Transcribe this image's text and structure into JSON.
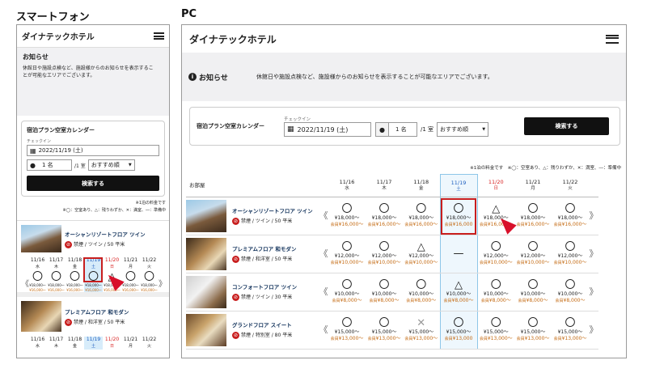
{
  "labels": {
    "sp": "スマートフォン",
    "pc": "PC"
  },
  "hotel": "ダイナテックホテル",
  "announce": {
    "title": "お知らせ",
    "body": "休館日や施設点検など、施設様からのお知らせを表示することが可能なエリアでございます。",
    "body_sp1": "休館日や施設点検など、施設様からのお知らせを表示するこ",
    "body_sp2": "とが可能なエリアでございます。"
  },
  "calendar": {
    "title": "宿泊プラン空室カレンダー",
    "checkin_label": "チェックイン",
    "date": "2022/11/19 (土)",
    "persons": "1 名",
    "per_room": "/1 室",
    "sort": "おすすめ順",
    "search": "検索する"
  },
  "note1": "※1泊の料金です",
  "note2": "※◯：空室あり、△：残りわずか、✕：満室、―：準備中",
  "note_pc": "※1泊の料金です　※◯：空室あり、△：残りわずか、✕：満室、―：準備中",
  "room_header": "お部屋",
  "dates": [
    {
      "d": "11/16",
      "w": "水",
      "c": ""
    },
    {
      "d": "11/17",
      "w": "木",
      "c": ""
    },
    {
      "d": "11/18",
      "w": "金",
      "c": ""
    },
    {
      "d": "11/19",
      "w": "土",
      "c": "blu"
    },
    {
      "d": "11/20",
      "w": "日",
      "c": "red"
    },
    {
      "d": "11/21",
      "w": "月",
      "c": ""
    },
    {
      "d": "11/22",
      "w": "火",
      "c": ""
    }
  ],
  "rooms": [
    {
      "name": "オーシャンリゾートフロア ツイン",
      "spec": "禁煙 / ツイン / 50 平米",
      "img": "a",
      "cells": [
        [
          "〇",
          "¥18,000～",
          "¥16,000～"
        ],
        [
          "〇",
          "¥18,000～",
          "¥16,000～"
        ],
        [
          "〇",
          "¥18,000～",
          "¥16,000～"
        ],
        [
          "〇",
          "¥18,000～",
          "¥16,000"
        ],
        [
          "△",
          "¥18,000～",
          "¥16,000～"
        ],
        [
          "〇",
          "¥18,000～",
          "¥16,000～"
        ],
        [
          "〇",
          "¥18,000～",
          "¥16,000～"
        ]
      ]
    },
    {
      "name": "プレミアムフロア 和モダン",
      "spec": "禁煙 / 和洋室 / 50 平米",
      "img": "b",
      "cells": [
        [
          "〇",
          "¥12,000～",
          "¥10,000～"
        ],
        [
          "〇",
          "¥12,000～",
          "¥10,000～"
        ],
        [
          "△",
          "¥12,000～",
          "¥10,000～"
        ],
        [
          "—",
          "",
          ""
        ],
        [
          "〇",
          "¥12,000～",
          "¥10,000～"
        ],
        [
          "〇",
          "¥12,000～",
          "¥10,000～"
        ],
        [
          "〇",
          "¥12,000～",
          "¥10,000～"
        ]
      ]
    },
    {
      "name": "コンフォートフロア ツイン",
      "spec": "禁煙 / ツイン / 30 平米",
      "img": "c",
      "cells": [
        [
          "〇",
          "¥10,000～",
          "¥8,000～"
        ],
        [
          "〇",
          "¥10,000～",
          "¥8,000～"
        ],
        [
          "〇",
          "¥10,000～",
          "¥8,000～"
        ],
        [
          "△",
          "¥10,000～",
          "¥8,000～"
        ],
        [
          "〇",
          "¥10,000～",
          "¥8,000～"
        ],
        [
          "〇",
          "¥10,000～",
          "¥8,000～"
        ],
        [
          "〇",
          "¥10,000～",
          "¥8,000～"
        ]
      ]
    },
    {
      "name": "グランドフロア スイート",
      "spec": "禁煙 / 特別室 / 80 平米",
      "img": "d",
      "cells": [
        [
          "〇",
          "¥15,000～",
          "¥13,000～"
        ],
        [
          "〇",
          "¥15,000～",
          "¥13,000～"
        ],
        [
          "✕",
          "¥15,000～",
          "¥13,000～"
        ],
        [
          "〇",
          "¥15,000～",
          "¥13,000"
        ],
        [
          "〇",
          "¥15,000～",
          "¥13,000～"
        ],
        [
          "〇",
          "¥15,000～",
          "¥13,000～"
        ],
        [
          "〇",
          "¥15,000～",
          "¥13,000～"
        ]
      ]
    }
  ],
  "member": "会員",
  "nosmoke": "🚭",
  "sp_rooms": [
    {
      "name": "オーシャンリゾートフロア ツイン",
      "spec": "禁煙 / ツイン / 50 平米",
      "img": "a",
      "syms": [
        "〇",
        "〇",
        "〇",
        "〇",
        "△",
        "〇",
        "〇"
      ],
      "p1": [
        "¥18,000～",
        "¥18,000～",
        "¥18,000～",
        "¥18,000～",
        "¥18,000～",
        "¥18,000～",
        "¥18,000～"
      ],
      "p2": [
        "¥16,000～",
        "¥16,000～",
        "¥16,000～",
        "¥16,000～",
        "¥16,000～",
        "¥16,000～",
        "¥16,000～"
      ]
    },
    {
      "name": "プレミアムフロア 和モダン",
      "spec": "禁煙 / 和洋室 / 50 平米",
      "img": "b",
      "syms": [
        "",
        "",
        "",
        "",
        "",
        "",
        ""
      ],
      "p1": [],
      "p2": []
    }
  ],
  "sp_member_prefix": "通常"
}
